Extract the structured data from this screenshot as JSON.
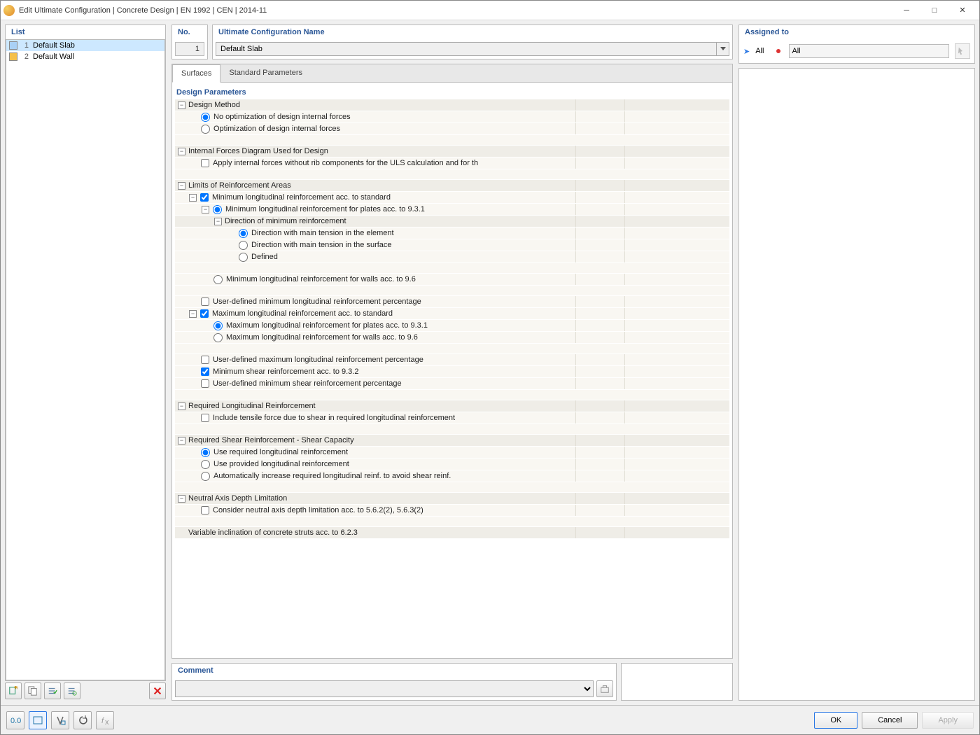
{
  "window": {
    "title": "Edit Ultimate Configuration | Concrete Design | EN 1992 | CEN | 2014-11"
  },
  "left": {
    "header": "List",
    "items": [
      {
        "num": "1",
        "label": "Default Slab",
        "color": "#a9d0f5",
        "selected": true
      },
      {
        "num": "2",
        "label": "Default Wall",
        "color": "#f5c04a",
        "selected": false
      }
    ]
  },
  "center": {
    "no_label": "No.",
    "no_value": "1",
    "name_label": "Ultimate Configuration Name",
    "name_value": "Default Slab",
    "tabs": {
      "surfaces": "Surfaces",
      "standard": "Standard Parameters"
    },
    "section": "Design Parameters",
    "groups": {
      "design_method": "Design Method",
      "design_method_o1": "No optimization of design internal forces",
      "design_method_o2": "Optimization of design internal forces",
      "internal_forces": "Internal Forces Diagram Used for Design",
      "internal_forces_c1": "Apply internal forces without rib components for the ULS calculation and for th",
      "limits": "Limits of Reinforcement Areas",
      "limits_min_std": "Minimum longitudinal reinforcement acc. to standard",
      "limits_min_plates": "Minimum longitudinal reinforcement for plates acc. to 9.3.1",
      "limits_dir_head": "Direction of minimum reinforcement",
      "limits_dir_1": "Direction with main tension in the element",
      "limits_dir_2": "Direction with main tension in the surface",
      "limits_dir_3": "Defined",
      "limits_min_walls": "Minimum longitudinal reinforcement for walls acc. to 9.6",
      "limits_user_min": "User-defined minimum longitudinal reinforcement percentage",
      "limits_max_std": "Maximum longitudinal reinforcement acc. to standard",
      "limits_max_plates": "Maximum longitudinal reinforcement for plates acc. to 9.3.1",
      "limits_max_walls": "Maximum longitudinal reinforcement for walls acc. to 9.6",
      "limits_user_max": "User-defined maximum longitudinal reinforcement percentage",
      "limits_min_shear": "Minimum shear reinforcement acc. to 9.3.2",
      "limits_user_shear": "User-defined minimum shear reinforcement percentage",
      "req_long": "Required Longitudinal Reinforcement",
      "req_long_c1": "Include tensile force due to shear in required longitudinal reinforcement",
      "req_shear": "Required Shear Reinforcement - Shear Capacity",
      "req_shear_o1": "Use required longitudinal reinforcement",
      "req_shear_o2": "Use provided longitudinal reinforcement",
      "req_shear_o3": "Automatically increase required longitudinal reinf. to avoid shear reinf.",
      "neutral": "Neutral Axis Depth Limitation",
      "neutral_c1": "Consider neutral axis depth limitation acc. to 5.6.2(2), 5.6.3(2)",
      "variable": "Variable inclination of concrete struts acc. to 6.2.3"
    },
    "comment_label": "Comment"
  },
  "right": {
    "header": "Assigned to",
    "all1": "All",
    "all2": "All"
  },
  "footer": {
    "ok": "OK",
    "cancel": "Cancel",
    "apply": "Apply"
  }
}
